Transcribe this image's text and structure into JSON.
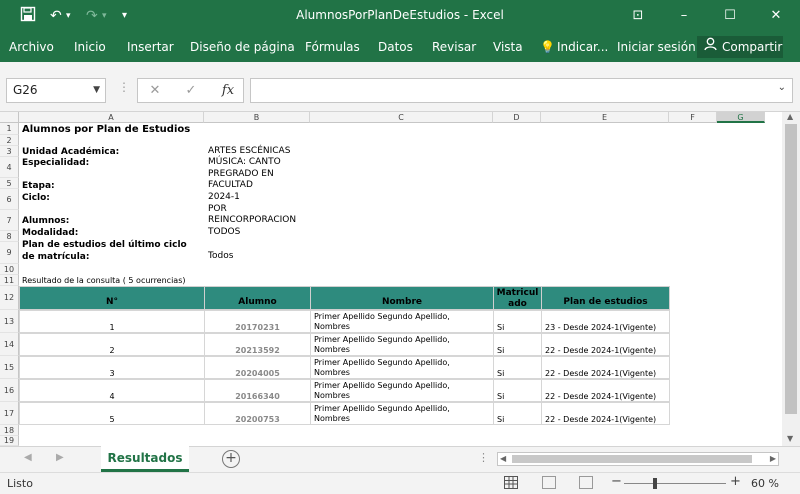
{
  "window": {
    "title": "AlumnosPorPlanDeEstudios - Excel",
    "minimize": "–",
    "restore": "☐",
    "close": "✕",
    "ribbon_display": "⊡"
  },
  "ribbon": {
    "tabs": [
      "Archivo",
      "Inicio",
      "Insertar",
      "Diseño de página",
      "Fórmulas",
      "Datos",
      "Revisar",
      "Vista",
      "Indicar...",
      "Iniciar sesión"
    ],
    "share": "Compartir"
  },
  "formula_bar": {
    "name_box": "G26",
    "fx": "fx",
    "formula": ""
  },
  "columns": [
    "A",
    "B",
    "C",
    "D",
    "E",
    "F",
    "G"
  ],
  "rows": [
    "1",
    "2",
    "3",
    "4",
    "5",
    "6",
    "7",
    "8",
    "9",
    "10",
    "11",
    "12",
    "13",
    "14",
    "15",
    "16",
    "17",
    "18",
    "19"
  ],
  "report": {
    "title": "Alumnos por Plan de Estudios",
    "labels": {
      "unidad": "Unidad Académica:",
      "especialidad": "Especialidad:",
      "etapa": "Etapa:",
      "ciclo": "Ciclo:",
      "alumnos": "Alumnos:",
      "modalidad": "Modalidad:",
      "plan_1": "Plan de estudios del último ciclo",
      "plan_2": "de matrícula:"
    },
    "values": {
      "unidad": "ARTES ESCÉNICAS",
      "especialidad": "MÚSICA: CANTO",
      "pregrado": "PREGRADO EN",
      "etapa": "FACULTAD",
      "ciclo": "2024-1",
      "alumnos_1": "POR",
      "alumnos_2": "REINCORPORACION",
      "modalidad": "TODOS",
      "plan": "Todos"
    },
    "result_text": "Resultado de la consulta ( 5 ocurrencias)",
    "table": {
      "headers": [
        "N°",
        "Alumno",
        "Nombre",
        "Matricul ado",
        "Plan de estudios"
      ],
      "rows": [
        {
          "n": "1",
          "alumno": "20170231",
          "nombre_1": "Primer Apellido Segundo Apellido,",
          "nombre_2": "Nombres",
          "matriculado": "Si",
          "plan": "23 - Desde 2024-1(Vigente)"
        },
        {
          "n": "2",
          "alumno": "20213592",
          "nombre_1": "Primer Apellido Segundo Apellido,",
          "nombre_2": "Nombres",
          "matriculado": "Si",
          "plan": "22 - Desde 2024-1(Vigente)"
        },
        {
          "n": "3",
          "alumno": "20204005",
          "nombre_1": "Primer Apellido Segundo Apellido,",
          "nombre_2": "Nombres",
          "matriculado": "Si",
          "plan": "22 - Desde 2024-1(Vigente)"
        },
        {
          "n": "4",
          "alumno": "20166340",
          "nombre_1": "Primer Apellido Segundo Apellido,",
          "nombre_2": "Nombres",
          "matriculado": "Si",
          "plan": "22 - Desde 2024-1(Vigente)"
        },
        {
          "n": "5",
          "alumno": "20200753",
          "nombre_1": "Primer Apellido Segundo Apellido,",
          "nombre_2": "Nombres",
          "matriculado": "Si",
          "plan": "22 - Desde 2024-1(Vigente)"
        }
      ]
    }
  },
  "sheet_tabs": {
    "active": "Resultados",
    "add": "+"
  },
  "status_bar": {
    "status": "Listo",
    "zoom": "60 %",
    "zoom_out": "−",
    "zoom_in": "+"
  },
  "colors": {
    "excel_green": "#217346",
    "header_teal": "#2e8b7e"
  }
}
